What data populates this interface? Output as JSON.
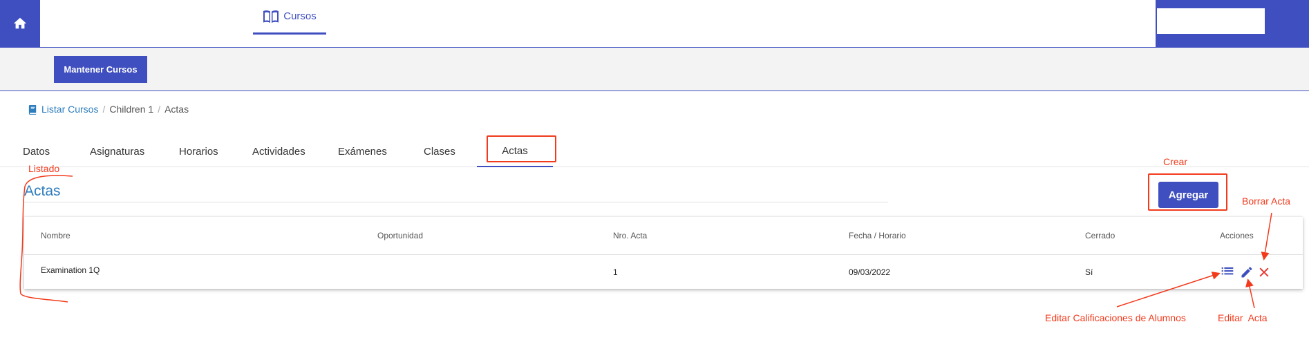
{
  "topbar": {
    "home_icon": "home-icon",
    "nav_cursos": {
      "label": "Cursos",
      "icon": "book-open-icon"
    }
  },
  "subbar": {
    "mantener_label": "Mantener Cursos"
  },
  "breadcrumb": {
    "items": [
      {
        "label": "Listar Cursos",
        "icon": "book-icon",
        "link": true
      },
      {
        "label": "Children 1",
        "link": false
      },
      {
        "label": "Actas",
        "link": false
      }
    ],
    "separator": "/"
  },
  "tabs": [
    {
      "label": "Datos"
    },
    {
      "label": "Asignaturas"
    },
    {
      "label": "Horarios"
    },
    {
      "label": "Actividades"
    },
    {
      "label": "Exámenes"
    },
    {
      "label": "Clases"
    },
    {
      "label": "Actas",
      "active": true
    }
  ],
  "section": {
    "title": "Actas",
    "add_label": "Agregar"
  },
  "table": {
    "columns": [
      "Nombre",
      "Oportunidad",
      "Nro. Acta",
      "Fecha / Horario",
      "Cerrado",
      "Acciones"
    ],
    "rows": [
      {
        "nombre": "Examination 1Q",
        "oportunidad": "",
        "nro_acta": "1",
        "fecha": "09/03/2022",
        "cerrado": "Sí",
        "actions": [
          "list-icon",
          "pencil-icon",
          "close-icon"
        ]
      }
    ]
  },
  "annotations": {
    "listado": "Listado",
    "crear": "Crear",
    "borrar": "Borrar Acta",
    "editar_calif": "Editar Calificaciones de Alumnos",
    "editar_acta": "Editar  Acta"
  },
  "colors": {
    "primary": "#3f4fbf",
    "link": "#2e7dbd",
    "annotation": "#f23a1c",
    "danger": "#e53935"
  }
}
